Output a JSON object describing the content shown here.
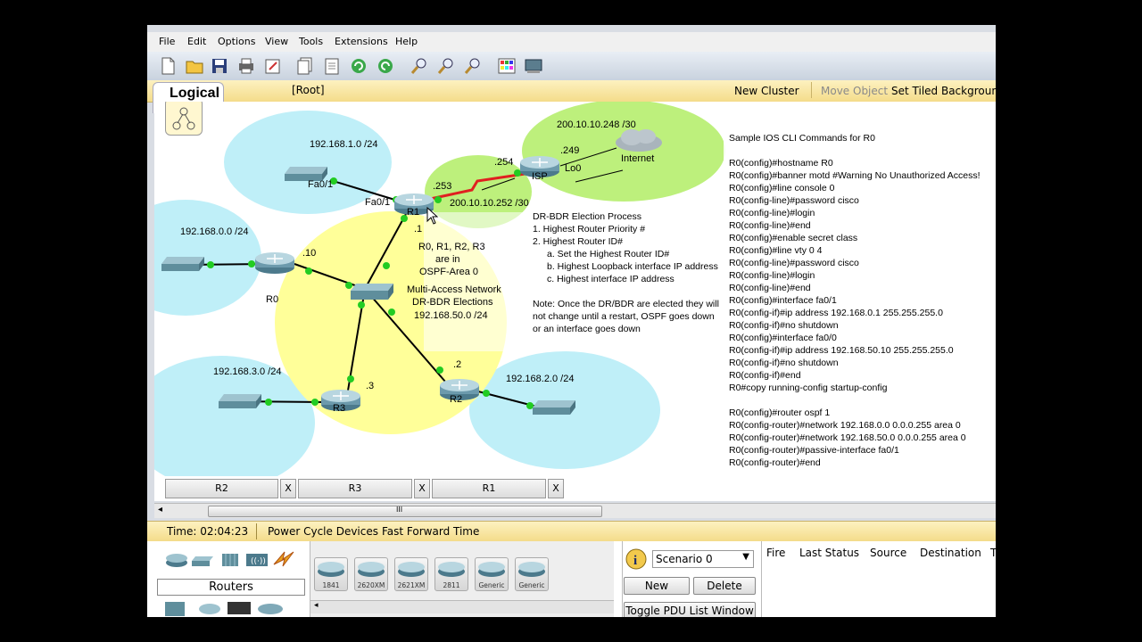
{
  "menu": [
    "File",
    "Edit",
    "Options",
    "View",
    "Tools",
    "Extensions",
    "Help"
  ],
  "workspace": {
    "tab_label": "Logical",
    "root_label": "[Root]",
    "new_cluster": "New Cluster",
    "move_object": "Move Object",
    "set_tiled_background": "Set Tiled Backgrounc"
  },
  "topology": {
    "networks": [
      "192.168.1.0 /24",
      "192.168.0.0 /24",
      "192.168.3.0 /24",
      "192.168.2.0 /24",
      "200.10.10.248 /30",
      "200.10.10.252 /30",
      "192.168.50.0 /24"
    ],
    "devices": [
      "R0",
      "R1",
      "R2",
      "R3",
      "ISP",
      "Internet"
    ],
    "interfaces": [
      "Fa0/1",
      "Fa0/1",
      "Lo0"
    ],
    "ip_suffixes": [
      ".1",
      ".10",
      ".2",
      ".3",
      ".253",
      ".254",
      ".249"
    ],
    "area_note": [
      "R0, R1, R2, R3",
      "are in",
      "OSPF-Area 0"
    ],
    "multiaccess": [
      "Multi-Access Network",
      "DR-BDR Elections"
    ]
  },
  "dr_bdr_note": [
    "DR-BDR Election Process",
    "1. Highest Router Priority #",
    "2. Highest Router ID#",
    "    a. Set the Highest Router ID#",
    "    b. Highest Loopback interface IP address",
    "    c. Highest interface IP address",
    "",
    "Note: Once the DR/BDR are elected they will",
    "not change until a restart, OSPF goes down",
    "or an interface goes down"
  ],
  "cli_commands": [
    "Sample IOS CLI Commands for R0",
    "",
    "R0(config)#hostname R0",
    "R0(config)#banner motd #Warning No Unauthorized Access!",
    "R0(config)#line console 0",
    "R0(config-line)#password cisco",
    "R0(config-line)#login",
    "R0(config-line)#end",
    "R0(config)#enable secret class",
    "R0(config)#line vty 0 4",
    "R0(config-line)#password cisco",
    "R0(config-line)#login",
    "R0(config-line)#end",
    "R0(config)#interface fa0/1",
    "R0(config-if)#ip address 192.168.0.1 255.255.255.0",
    "R0(config-if)#no shutdown",
    "R0(config)#interface fa0/0",
    "R0(config-if)#ip address 192.168.50.10 255.255.255.0",
    "R0(config-if)#no shutdown",
    "R0(config-if)#end",
    "R0#copy running-config startup-config",
    "",
    "R0(config)#router ospf 1",
    "R0(config-router)#network 192.168.0.0 0.0.0.255 area 0",
    "R0(config-router)#network 192.168.50.0 0.0.0.255 area 0",
    "R0(config-router)#passive-interface fa0/1",
    "R0(config-router)#end"
  ],
  "device_tabs": [
    "R2",
    "R3",
    "R1"
  ],
  "close_glyph": "X",
  "scroll_grip": "III",
  "timebar": {
    "time": "Time: 02:04:23",
    "power_cycle": "Power Cycle Devices",
    "fast_forward": "Fast Forward Time"
  },
  "device_category": "Routers",
  "router_models": [
    "1841",
    "2620XM",
    "2621XM",
    "2811",
    "Generic",
    "Generic"
  ],
  "scenario": {
    "selected": "Scenario 0",
    "new": "New",
    "delete": "Delete",
    "toggle": "Toggle PDU List Window"
  },
  "pdu_columns": [
    "Fire",
    "Last Status",
    "Source",
    "Destination",
    "T"
  ],
  "colors": {
    "cyan": "#bfeff8",
    "yellow": "#ffff99",
    "green": "#bdf07c",
    "link": "#000000",
    "serial": "#e02020",
    "port": "#22cc22"
  }
}
